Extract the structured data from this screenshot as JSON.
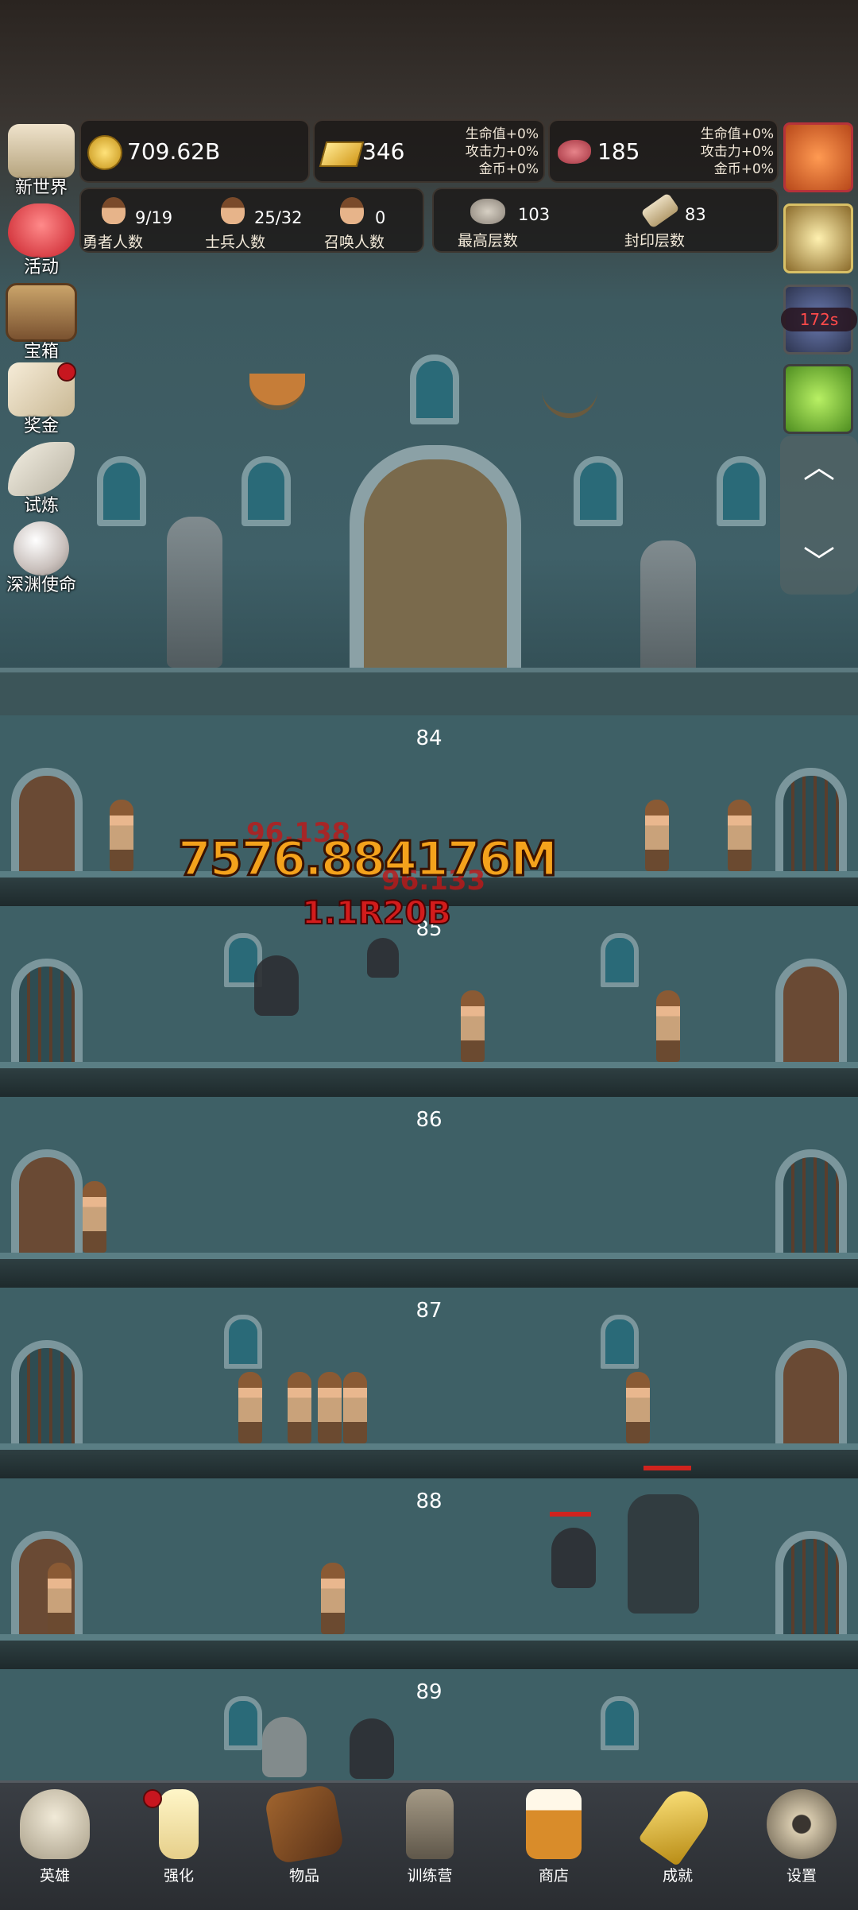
{
  "resources": {
    "coins": "709.62B",
    "gold_bars": "346",
    "meat": "185",
    "gold_bonus": {
      "hp": "生命值+0%",
      "atk": "攻击力+0%",
      "coin": "金币+0%"
    },
    "meat_bonus": {
      "hp": "生命值+0%",
      "atk": "攻击力+0%",
      "coin": "金币+0%"
    }
  },
  "stats": {
    "heroes": {
      "value": "9/19",
      "label": "勇者人数"
    },
    "soldiers": {
      "value": "25/32",
      "label": "士兵人数"
    },
    "summons": {
      "value": "0",
      "label": "召唤人数"
    },
    "highest_floor": {
      "value": "103",
      "label": "最高层数"
    },
    "sealed_floor": {
      "value": "83",
      "label": "封印层数"
    }
  },
  "left_menu": [
    {
      "label": "新世界",
      "icon": "map-icon"
    },
    {
      "label": "活动",
      "icon": "heart-icon"
    },
    {
      "label": "宝箱",
      "icon": "chest-icon"
    },
    {
      "label": "奖金",
      "icon": "envelope-icon"
    },
    {
      "label": "试炼",
      "icon": "wing-icon"
    },
    {
      "label": "深渊使命",
      "icon": "pearl-icon"
    }
  ],
  "right_buttons": [
    {
      "icon": "pumpkin-icon"
    },
    {
      "icon": "candle-icon"
    },
    {
      "icon": "mushroom-timer-icon",
      "timer": "172s"
    },
    {
      "icon": "slime-icon"
    }
  ],
  "floors": [
    "84",
    "85",
    "86",
    "87",
    "88",
    "89"
  ],
  "damage": {
    "main": "7576.884",
    "main_suffix": "176M",
    "secondary": "1.1R20B",
    "faint1": "96.138",
    "faint2": "96.133"
  },
  "nav": [
    {
      "label": "英雄",
      "icon": "skull-icon"
    },
    {
      "label": "强化",
      "icon": "candle-icon"
    },
    {
      "label": "物品",
      "icon": "book-icon"
    },
    {
      "label": "训练营",
      "icon": "lantern-icon"
    },
    {
      "label": "商店",
      "icon": "beer-mug-icon"
    },
    {
      "label": "成就",
      "icon": "key-icon"
    },
    {
      "label": "设置",
      "icon": "gear-icon"
    }
  ],
  "colors": {
    "gold": "#d49b1c",
    "red_dot": "#c7161f",
    "damage_orange": "#f0a020",
    "damage_red": "#d21c1c"
  }
}
